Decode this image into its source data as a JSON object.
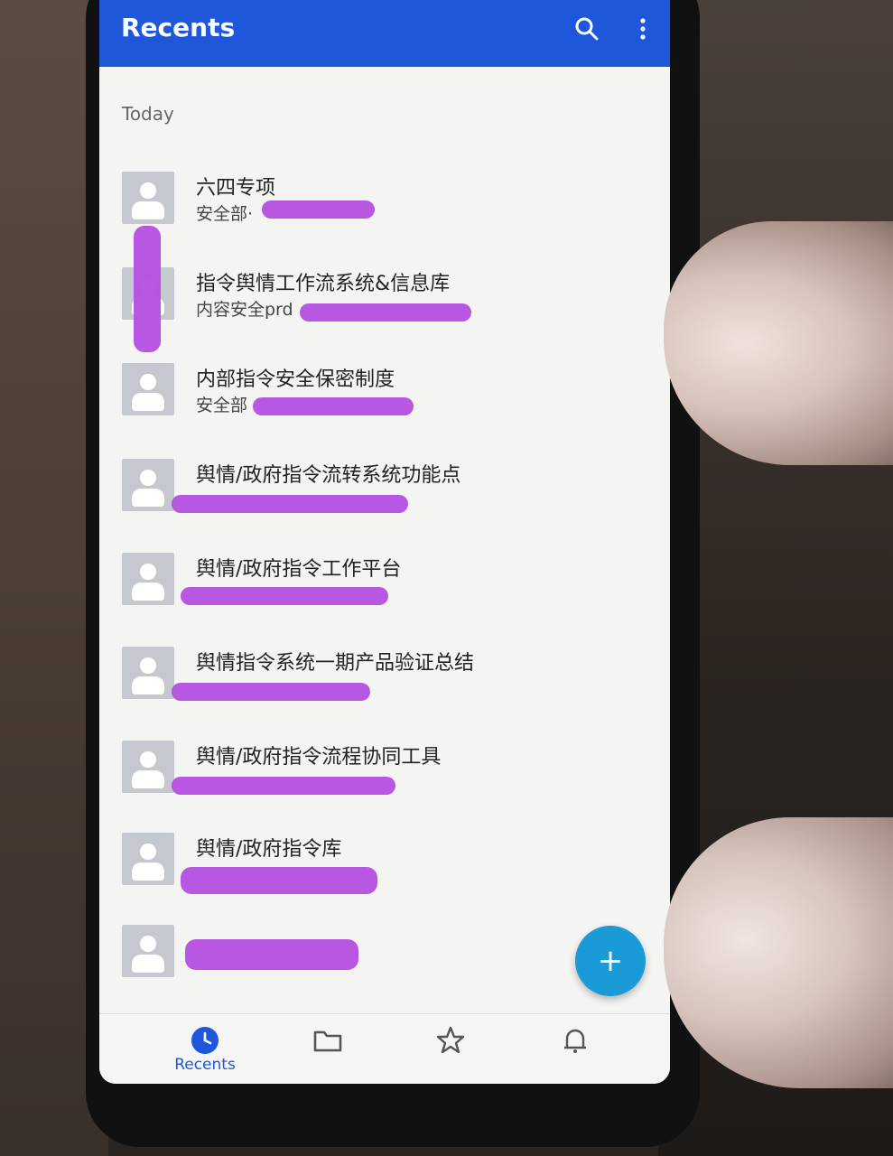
{
  "appbar": {
    "title": "Recents",
    "color": "#1f57db",
    "icons": [
      "search-icon",
      "more-vert-icon"
    ]
  },
  "section_label": "Today",
  "items": [
    {
      "title": "六四专项",
      "subtitle": "安全部·"
    },
    {
      "title": "指令舆情工作流系统&信息库",
      "subtitle": "内容安全prd"
    },
    {
      "title": "内部指令安全保密制度",
      "subtitle": "安全部"
    },
    {
      "title": "舆情/政府指令流转系统功能点",
      "subtitle": ""
    },
    {
      "title": "舆情/政府指令工作平台",
      "subtitle": ""
    },
    {
      "title": "舆情指令系统一期产品验证总结",
      "subtitle": ""
    },
    {
      "title": "舆情/政府指令流程协同工具",
      "subtitle": ""
    },
    {
      "title": "舆情/政府指令库",
      "subtitle": ""
    },
    {
      "title": "",
      "subtitle": ""
    }
  ],
  "fab": {
    "label": "+",
    "color": "#1a9ad6"
  },
  "bottom_nav": [
    {
      "label": "Recents",
      "icon": "clock-icon",
      "active": true
    },
    {
      "label": "",
      "icon": "folder-icon",
      "active": false
    },
    {
      "label": "",
      "icon": "star-icon",
      "active": false
    },
    {
      "label": "",
      "icon": "bell-icon",
      "active": false
    }
  ]
}
